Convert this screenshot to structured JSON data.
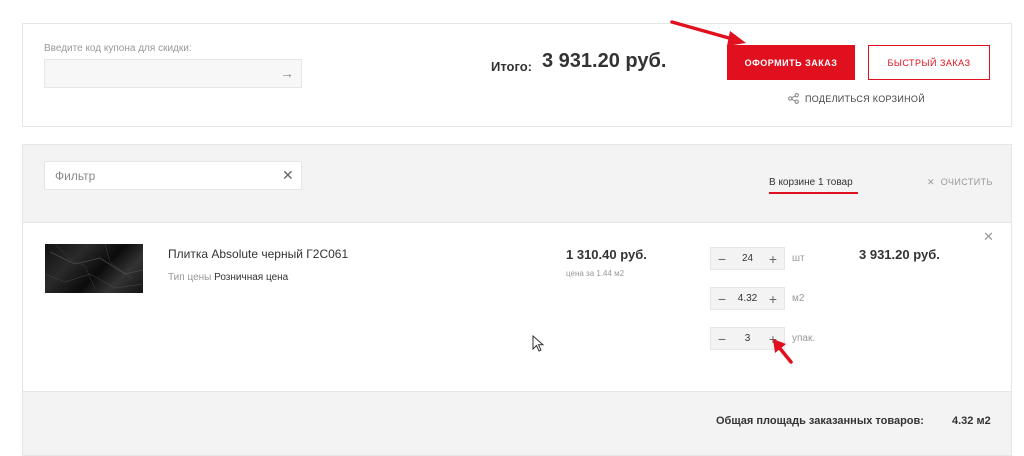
{
  "summary": {
    "coupon_label": "Введите код купона для скидки:",
    "coupon_value": "",
    "total_label": "Итого:",
    "total_value": "3 931.20 руб.",
    "order_button": "ОФОРМИТЬ ЗАКАЗ",
    "quick_order_button": "БЫСТРЫЙ ЗАКАЗ",
    "share_label": "ПОДЕЛИТЬСЯ КОРЗИНОЙ"
  },
  "filter": {
    "placeholder": "Фильтр",
    "clear_icon": "close-icon",
    "basket_count": "В корзине 1 товар",
    "clear_all": "ОЧИСТИТЬ"
  },
  "item": {
    "name": "Плитка Absolute черный Г2С061",
    "price_type_label": "Тип цены",
    "price_type_value": "Розничная цена",
    "unit_price": "1 310.40 руб.",
    "price_note": "цена за 1.44 м2",
    "quantities": [
      {
        "value": "24",
        "unit": "шт"
      },
      {
        "value": "4.32",
        "unit": "м2"
      },
      {
        "value": "3",
        "unit": "упак."
      }
    ],
    "line_total": "3 931.20 руб."
  },
  "footer": {
    "area_label": "Общая площадь заказанных товаров:",
    "area_value": "4.32 м2"
  },
  "colors": {
    "accent": "#e0101f",
    "panel_bg": "#f3f3f3",
    "border": "#e6e6e6"
  }
}
